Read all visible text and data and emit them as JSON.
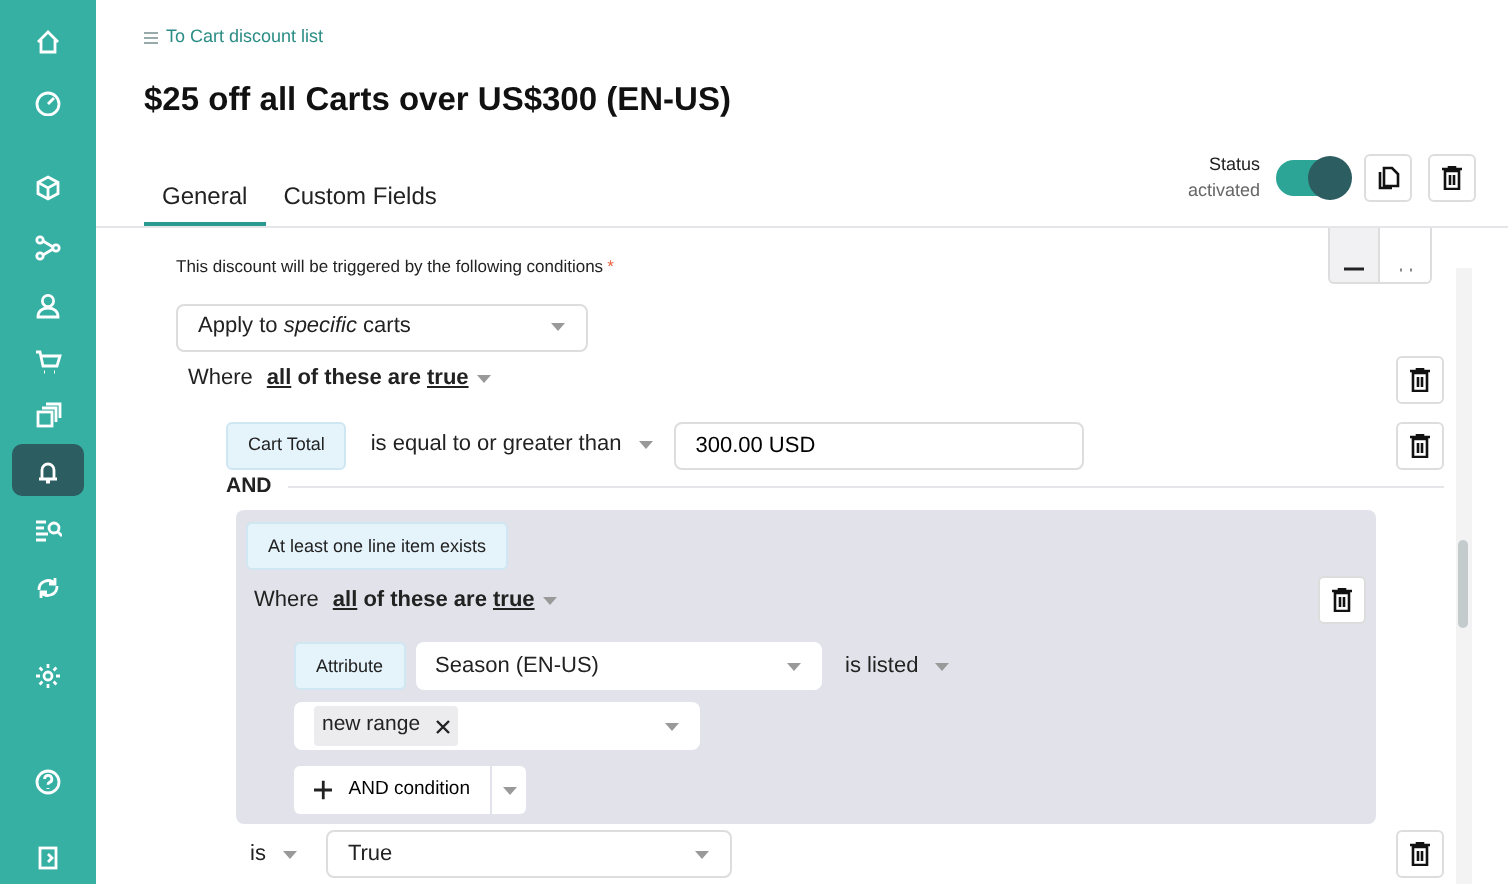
{
  "sidebar": {
    "items": [
      {
        "selected": false
      },
      {
        "selected": false
      },
      {
        "selected": false
      },
      {
        "selected": false
      },
      {
        "selected": false
      },
      {
        "selected": false
      },
      {
        "selected": false
      },
      {
        "selected": true
      },
      {
        "selected": false
      },
      {
        "selected": false
      },
      {
        "selected": false
      },
      {
        "selected": false
      },
      {
        "selected": false
      }
    ]
  },
  "breadcrumb": "To Cart discount list",
  "title": "$25 off all Carts over US$300 (EN-US)",
  "tabs": [
    {
      "label": "General",
      "selected": true
    },
    {
      "label": "Custom Fields",
      "selected": false
    }
  ],
  "view_options": [
    {
      "selected": true
    },
    {
      "selected": false
    }
  ],
  "status": {
    "label": "Status",
    "value": "activated",
    "on": true
  },
  "conditions": {
    "label": "This discount will be triggered by the following conditions",
    "required_mark": "*",
    "apply_select": "Apply to *specific* carts",
    "where": {
      "prefix": "Where",
      "quantifier": "all",
      "middle": "of these are",
      "truth": "true"
    },
    "rule": {
      "field": "Cart Total",
      "operator": "is equal to or greater than",
      "value": "300.00 USD"
    },
    "connector": "AND",
    "group": {
      "title": "At least one line item exists",
      "where": {
        "prefix": "Where",
        "quantifier": "all",
        "middle": "of these are",
        "truth": "true"
      },
      "rule": {
        "badge": "Attribute",
        "attribute": "Season (EN-US)",
        "operator": "is listed",
        "tags": [
          "new range"
        ]
      },
      "add_button": "AND condition"
    },
    "result": {
      "operator": "is",
      "value": "True"
    }
  }
}
